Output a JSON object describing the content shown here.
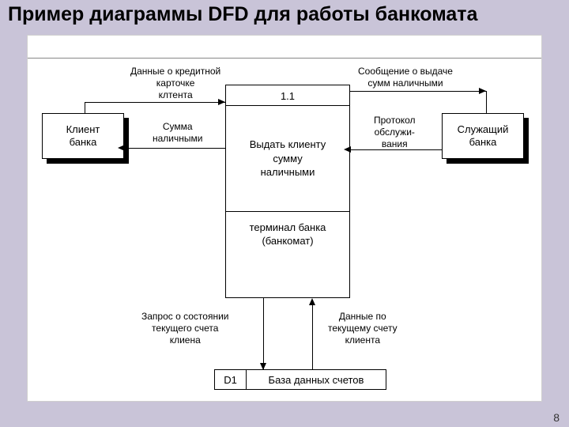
{
  "title": "Пример диаграммы DFD для работы банкомата",
  "page_number": "8",
  "entities": {
    "left": "Клиент\nбанка",
    "right": "Служащий\nбанка"
  },
  "process": {
    "id": "1.1",
    "name": "Выдать клиенту\nсумму\nналичными",
    "mechanism": "терминал банка\n(банкомат)"
  },
  "datastore": {
    "id": "D1",
    "name": "База данных счетов"
  },
  "flows": {
    "top_left": "Данные о кредитной\nкарточке\nклтента",
    "mid_left": "Сумма\nналичными",
    "top_right": "Сообщение о выдаче\nсумм наличными",
    "mid_right": "Протокол\nобслужи-\nвания",
    "bottom_left": "Запрос о состоянии\nтекущего счета\nклиена",
    "bottom_right": "Данные по\nтекущему счету\nклиента"
  }
}
